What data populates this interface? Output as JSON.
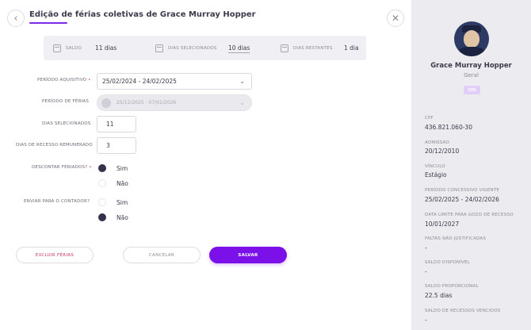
{
  "header": {
    "title": "Edição de férias coletivas de Grace Murray Hopper",
    "back_icon": "chevron-left-icon",
    "close_icon": "close-icon"
  },
  "summary": {
    "saldo_label": "SALDO",
    "saldo_value": "11 dias",
    "selecionados_label": "DIAS SELECIONADOS",
    "selecionados_value": "10 dias",
    "restantes_label": "DIAS RESTANTES",
    "restantes_value": "1 dia"
  },
  "form": {
    "periodo_aquisitivo_label": "PERÍODO AQUISITIVO",
    "periodo_aquisitivo_value": "25/02/2024 - 24/02/2025",
    "periodo_ferias_label": "PERÍODO DE FÉRIAS",
    "periodo_ferias_value": "25/12/2025 - 07/01/2026",
    "dias_selecionados_label": "DIAS SELECIONADOS",
    "dias_selecionados_value": "11",
    "dias_recesso_label": "DIAS DE RECESSO REMUNERADO",
    "dias_recesso_value": "3",
    "descontar_feriados_label": "DESCONTAR FERIADOS?",
    "descontar_feriados_options": [
      "Sim",
      "Não"
    ],
    "descontar_feriados_selected": "Sim",
    "enviar_contador_label": "ENVIAR PARA O CONTADOR?",
    "enviar_contador_options": [
      "Sim",
      "Não"
    ],
    "enviar_contador_selected": "Não"
  },
  "actions": {
    "delete_label": "EXCLUIR FÉRIAS",
    "cancel_label": "CANCELAR",
    "save_label": "SALVAR"
  },
  "colors": {
    "accent": "#7b10e8",
    "danger": "#c2396b",
    "sidebar_bg": "#ececf0"
  },
  "person": {
    "name": "Grace Murray Hopper",
    "department": "Geral",
    "badge": "CFA",
    "info": [
      {
        "label": "CPF",
        "value": "436.821.060-30"
      },
      {
        "label": "ADMISSÃO",
        "value": "20/12/2010"
      },
      {
        "label": "VÍNCULO",
        "value": "Estágio"
      },
      {
        "label": "PERÍODO CONCESSIVO VIGENTE",
        "value": "25/02/2025 - 24/02/2026"
      },
      {
        "label": "DATA LIMITE PARA GOZO DE RECESSO",
        "value": "10/01/2027"
      },
      {
        "label": "FALTAS NÃO JUSTIFICADAS",
        "value": "-"
      },
      {
        "label": "SALDO DISPONÍVEL",
        "value": "-"
      },
      {
        "label": "SALDO PROPORCIONAL",
        "value": "22.5 dias"
      },
      {
        "label": "SALDO DE RECESSOS VENCIDOS",
        "value": "-"
      }
    ]
  }
}
